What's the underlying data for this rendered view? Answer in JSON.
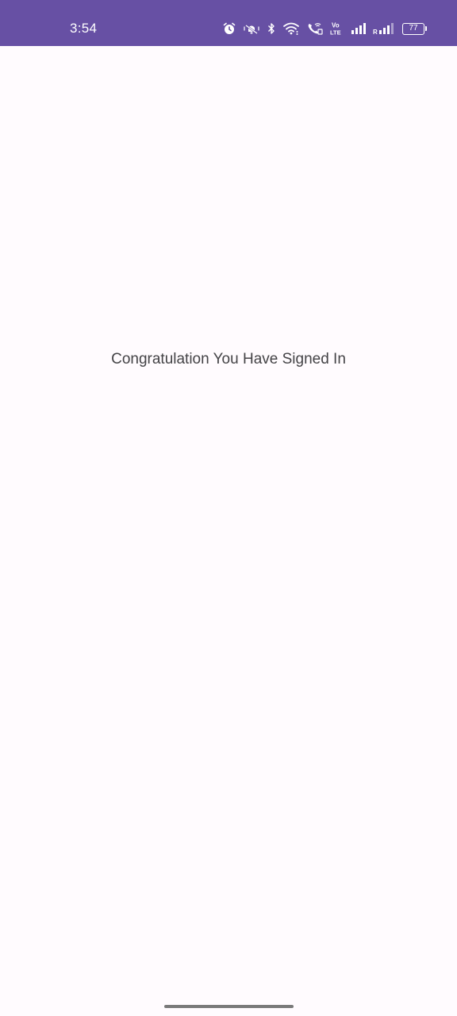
{
  "status_bar": {
    "time": "3:54",
    "battery_level": "77",
    "background_color": "#6750a4",
    "icons": [
      "alarm-icon",
      "vibrate-icon",
      "bluetooth-icon",
      "wifi-icon",
      "wifi-calling-icon",
      "volte-icon",
      "signal-icon",
      "signal-roaming-icon",
      "battery-icon"
    ],
    "volte_label_top": "Vo",
    "volte_label_bottom": "LTE",
    "roaming_label": "R"
  },
  "main": {
    "message": "Congratulation You Have Signed In",
    "background_color": "#fffbfe"
  }
}
